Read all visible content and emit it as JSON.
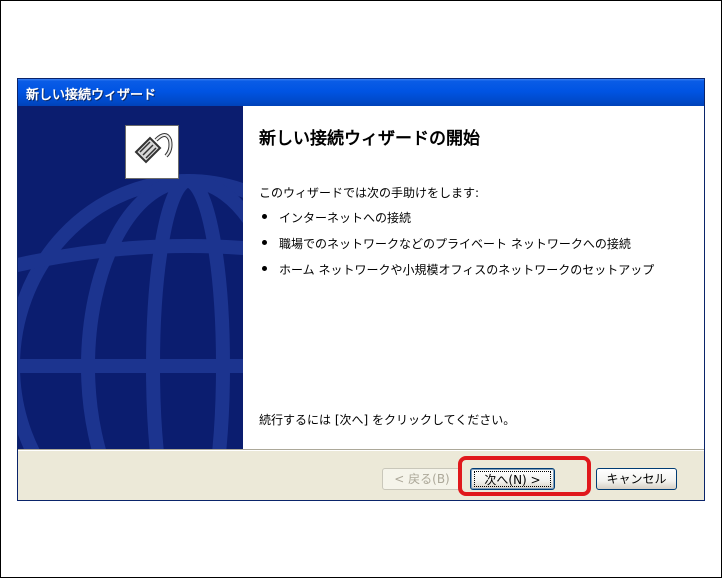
{
  "dialog": {
    "title": "新しい接続ウィザード",
    "heading": "新しい接続ウィザードの開始",
    "intro": "このウィザードでは次の手助けをします:",
    "bullets": [
      "インターネットへの接続",
      "職場でのネットワークなどのプライベート ネットワークへの接続",
      "ホーム ネットワークや小規模オフィスのネットワークのセットアップ"
    ],
    "footer": "続行するには [次へ] をクリックしてください。",
    "sidebar_icon": "network-cable-icon"
  },
  "buttons": {
    "back": "< 戻る(B)",
    "next": "次へ(N) >",
    "cancel": "キャンセル"
  },
  "colors": {
    "titlebar": "#0054e3",
    "sidebar": "#0b1d6f",
    "highlight": "#e0181c"
  }
}
